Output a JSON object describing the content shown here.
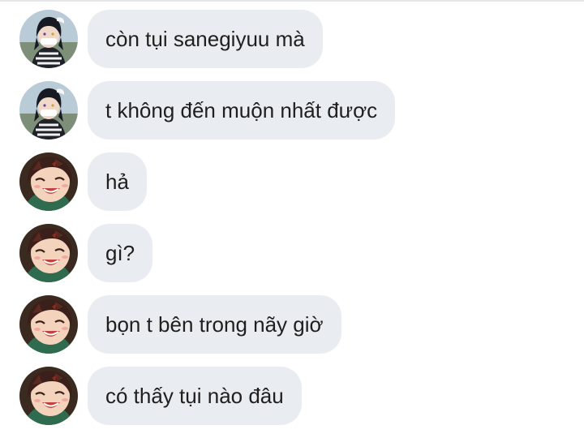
{
  "colors": {
    "bubble_bg": "#e9ecf0",
    "text": "#1f1f1f",
    "background": "#ffffff"
  },
  "messages": [
    {
      "avatar": "obanai-avatar",
      "text": "còn tụi sanegiyuu mà"
    },
    {
      "avatar": "obanai-avatar",
      "text": "t không đến muộn nhất được"
    },
    {
      "avatar": "tanjiro-avatar",
      "text": "hả"
    },
    {
      "avatar": "tanjiro-avatar",
      "text": "gì?"
    },
    {
      "avatar": "tanjiro-avatar",
      "text": "bọn t bên trong nãy giờ"
    },
    {
      "avatar": "tanjiro-avatar",
      "text": "có thấy tụi nào đâu"
    }
  ]
}
